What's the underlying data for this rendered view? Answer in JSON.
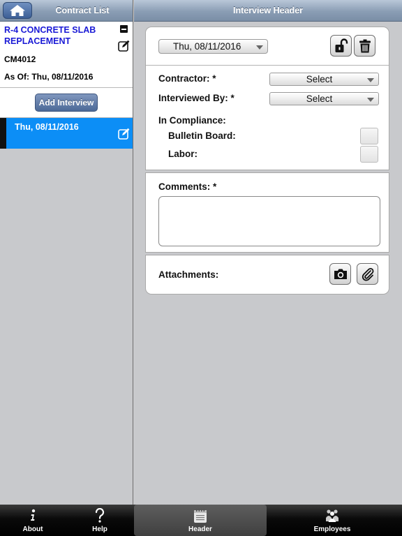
{
  "left": {
    "header_title": "Contract List",
    "contract": {
      "title": "R-4 CONCRETE SLAB REPLACEMENT",
      "id": "CM4012",
      "as_of": "As Of: Thu, 08/11/2016"
    },
    "add_interview_label": "Add Interview",
    "interviews": [
      {
        "date": "Thu, 08/11/2016",
        "selected": true
      }
    ]
  },
  "right": {
    "header_title": "Interview Header",
    "date_value": "Thu, 08/11/2016",
    "form": {
      "contractor_label": "Contractor: *",
      "contractor_value": "Select",
      "interviewed_by_label": "Interviewed By: *",
      "interviewed_by_value": "Select",
      "in_compliance_label": "In Compliance:",
      "bulletin_board_label": "Bulletin Board:",
      "labor_label": "Labor:",
      "comments_label": "Comments: *",
      "attachments_label": "Attachments:"
    }
  },
  "tabbar": {
    "about": "About",
    "help": "Help",
    "header": "Header",
    "employees": "Employees"
  },
  "colors": {
    "accent_blue": "#0c8ef6",
    "contract_title": "#1a1ad6",
    "nav_bar": "#8a9db4",
    "add_button": "#4d6997"
  },
  "icons": [
    "home-icon",
    "minus-square-icon",
    "edit-icon",
    "lock-open-icon",
    "trash-icon",
    "camera-icon",
    "paperclip-icon",
    "info-icon",
    "question-icon",
    "notepad-icon",
    "people-icon"
  ]
}
